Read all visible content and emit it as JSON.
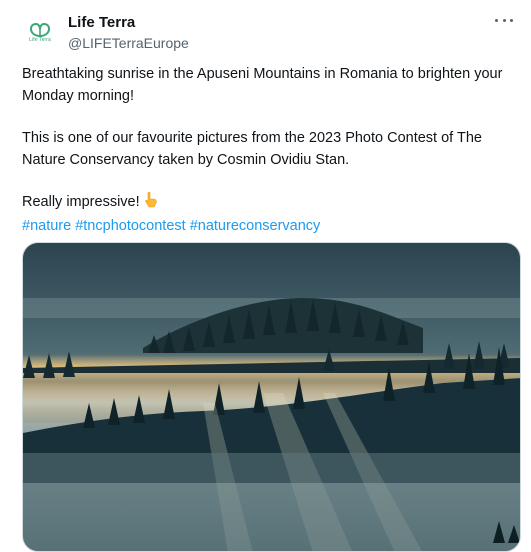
{
  "author": {
    "name": "Life Terra",
    "handle": "@LIFETerraEurope",
    "avatar_logo_text": "Life Terra",
    "avatar_icon": "life-terra-logo"
  },
  "more_icon": "ellipsis-icon",
  "tweet": {
    "line1": "Breathtaking sunrise in the Apuseni Mountains in Romania to brighten your Monday morning!",
    "line2": "This is one of our favourite pictures from the 2023 Photo Contest of The Nature Conservancy taken by Cosmin Ovidiu Stan.",
    "line3": "Really impressive!",
    "emoji": "pointing-down-hand",
    "hashtags": [
      "#nature",
      "#tncphotocontest",
      "#natureconservancy"
    ]
  },
  "media": {
    "description_icon": "photo-misty-forest",
    "colors": {
      "sky_top": "#2b4450",
      "glow": "#e8c07a",
      "mist": "#9fb3b5",
      "forest": "#12262c"
    }
  },
  "colors": {
    "link": "#1d9bf0",
    "muted": "#536471",
    "text": "#0f1419"
  }
}
